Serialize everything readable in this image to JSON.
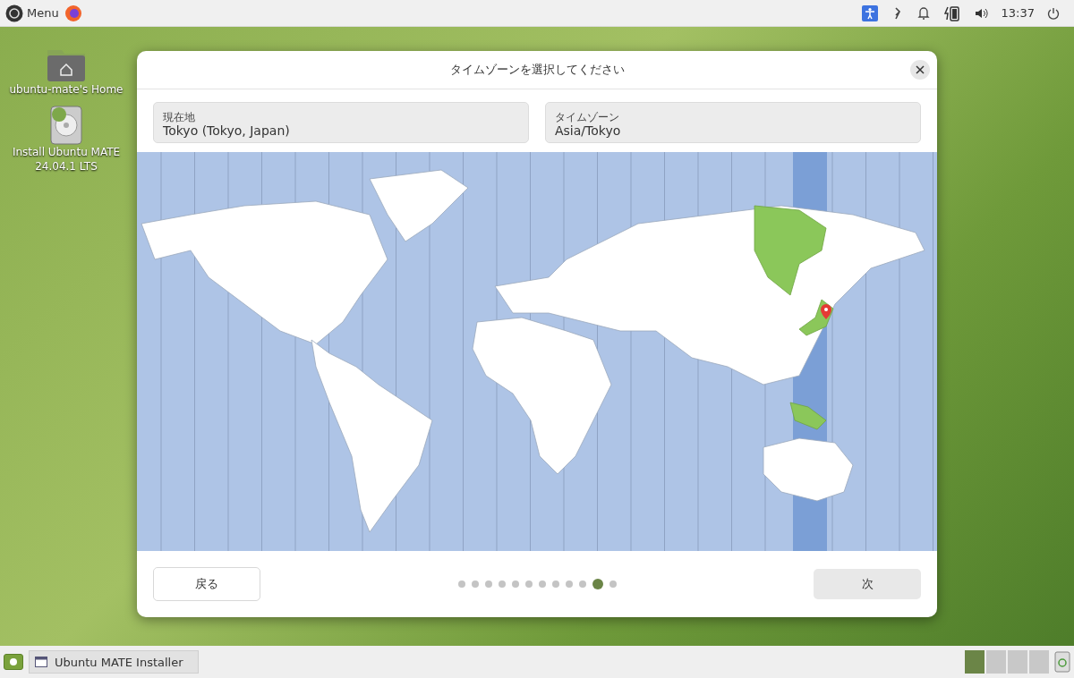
{
  "top_panel": {
    "menu_label": "Menu",
    "clock": "13:37"
  },
  "desktop_icons": [
    {
      "kind": "folder",
      "label": "ubuntu-mate's Home"
    },
    {
      "kind": "disk",
      "label": "Install Ubuntu MATE 24.04.1 LTS"
    }
  ],
  "dialog": {
    "title": "タイムゾーンを選択してください",
    "fields": [
      {
        "label": "現在地",
        "value": "Tokyo (Tokyo, Japan)"
      },
      {
        "label": "タイムゾーン",
        "value": "Asia/Tokyo"
      }
    ],
    "back_button": "戻る",
    "next_button": "次",
    "steps": [
      {
        "selected": false
      },
      {
        "selected": false
      },
      {
        "selected": false
      },
      {
        "selected": false
      },
      {
        "selected": false
      },
      {
        "selected": false
      },
      {
        "selected": false
      },
      {
        "selected": false
      },
      {
        "selected": false
      },
      {
        "selected": false
      },
      {
        "selected": true
      },
      {
        "selected": false
      }
    ]
  },
  "taskbar": {
    "windows": [
      {
        "label": "Ubuntu MATE Installer"
      }
    ],
    "workspaces": [
      {
        "selected": true
      },
      {
        "selected": false
      },
      {
        "selected": false
      },
      {
        "selected": false
      }
    ]
  }
}
